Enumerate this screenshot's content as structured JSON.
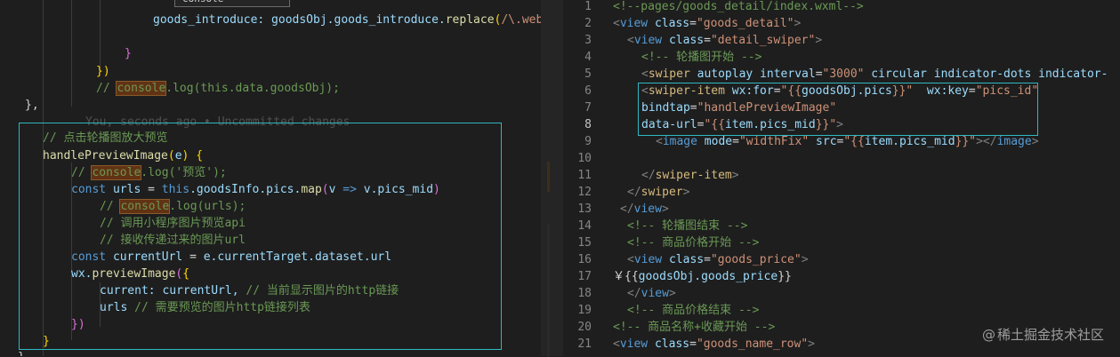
{
  "colors": {
    "background": "#1e1e1e",
    "selection_border": "#2fb8c3",
    "keyword": "#569cd6",
    "function": "#dcdcaa",
    "variable": "#9cdcfe",
    "string": "#ce9178",
    "comment": "#6a9955"
  },
  "left_editor": {
    "suggest_widget_label": "console",
    "lines": [
      [
        {
          "t": "goods_introduce: goodsObj.goods_introduce.",
          "c": "c-var"
        },
        {
          "t": "replace",
          "c": "c-fn"
        },
        {
          "t": "(",
          "c": "c-brk"
        },
        {
          "t": "/\\.webp/g",
          "c": "c-str"
        }
      ],
      [],
      [
        {
          "t": "}",
          "c": "c-brk2"
        }
      ],
      [
        {
          "t": "})",
          "c": "c-brk"
        }
      ],
      [
        {
          "t": "// ",
          "c": "c-cmt"
        },
        {
          "t": "console",
          "c": "c-cmt find"
        },
        {
          "t": ".log(this.data.goodsObj);",
          "c": "c-cmt"
        }
      ],
      [
        {
          "t": "},",
          "c": "c-pun"
        }
      ],
      [
        {
          "t": "You, seconds ago • Uncommitted changes",
          "c": "c-mute"
        }
      ],
      [
        {
          "t": "// 点击轮播图放大预览",
          "c": "c-cmt"
        }
      ],
      [
        {
          "t": "handlePreviewImage",
          "c": "c-fn"
        },
        {
          "t": "(",
          "c": "c-brk"
        },
        {
          "t": "e",
          "c": "c-var"
        },
        {
          "t": ") {",
          "c": "c-brk"
        }
      ],
      [
        {
          "t": "// ",
          "c": "c-cmt"
        },
        {
          "t": "console",
          "c": "c-cmt find"
        },
        {
          "t": ".log('预览');",
          "c": "c-cmt"
        }
      ],
      [
        {
          "t": "const ",
          "c": "c-kw"
        },
        {
          "t": "urls",
          "c": "c-var"
        },
        {
          "t": " = ",
          "c": "c-pun"
        },
        {
          "t": "this",
          "c": "c-kw"
        },
        {
          "t": ".goodsInfo.pics.",
          "c": "c-var"
        },
        {
          "t": "map",
          "c": "c-fn"
        },
        {
          "t": "(",
          "c": "c-brk2"
        },
        {
          "t": "v",
          "c": "c-var"
        },
        {
          "t": " => ",
          "c": "c-kw"
        },
        {
          "t": "v.pics_mid",
          "c": "c-var"
        },
        {
          "t": ")",
          "c": "c-brk2"
        }
      ],
      [
        {
          "t": "// ",
          "c": "c-cmt"
        },
        {
          "t": "console",
          "c": "c-cmt find"
        },
        {
          "t": ".log(urls);",
          "c": "c-cmt"
        }
      ],
      [
        {
          "t": "// 调用小程序图片预览api",
          "c": "c-cmt"
        }
      ],
      [
        {
          "t": "// 接收传递过来的图片url",
          "c": "c-cmt"
        }
      ],
      [
        {
          "t": "const ",
          "c": "c-kw"
        },
        {
          "t": "currentUrl",
          "c": "c-var"
        },
        {
          "t": " = ",
          "c": "c-pun"
        },
        {
          "t": "e.currentTarget.dataset.url",
          "c": "c-var"
        }
      ],
      [
        {
          "t": "wx.",
          "c": "c-var"
        },
        {
          "t": "previewImage",
          "c": "c-fn"
        },
        {
          "t": "(",
          "c": "c-brk2"
        },
        {
          "t": "{",
          "c": "c-brk"
        }
      ],
      [
        {
          "t": "current: currentUrl, ",
          "c": "c-var"
        },
        {
          "t": "// 当前显示图片的http链接",
          "c": "c-cmt"
        }
      ],
      [
        {
          "t": "urls ",
          "c": "c-var"
        },
        {
          "t": "// 需要预览的图片http链接列表",
          "c": "c-cmt"
        }
      ],
      [
        {
          "t": "})",
          "c": "c-brk2"
        }
      ],
      [
        {
          "t": "}",
          "c": "c-brk"
        }
      ],
      [
        {
          "t": "},",
          "c": "c-pun"
        }
      ]
    ]
  },
  "right_editor": {
    "line_numbers": [
      "1",
      "2",
      "3",
      "4",
      "5",
      "6",
      "7",
      "8",
      "9",
      "10",
      "11",
      "12",
      "13",
      "14",
      "15",
      "16",
      "17",
      "18",
      "19",
      "20",
      "21"
    ],
    "active_line": "8",
    "lines": [
      [
        {
          "t": "<!--pages/goods_detail/index.wxml-->",
          "c": "c-cmt"
        }
      ],
      [
        {
          "t": "<",
          "c": "c-tag-gray"
        },
        {
          "t": "view ",
          "c": "c-tag"
        },
        {
          "t": "class",
          "c": "c-attr"
        },
        {
          "t": "=",
          "c": "c-pun"
        },
        {
          "t": "\"goods_detail\"",
          "c": "c-str"
        },
        {
          "t": ">",
          "c": "c-tag-gray"
        }
      ],
      [
        {
          "t": "<",
          "c": "c-tag-gray"
        },
        {
          "t": "view ",
          "c": "c-tag"
        },
        {
          "t": "class",
          "c": "c-attr"
        },
        {
          "t": "=",
          "c": "c-pun"
        },
        {
          "t": "\"detail_swiper\"",
          "c": "c-str"
        },
        {
          "t": ">",
          "c": "c-tag-gray"
        }
      ],
      [
        {
          "t": "<!-- 轮播图开始 -->",
          "c": "c-cmt"
        }
      ],
      [
        {
          "t": "<",
          "c": "c-tag-gray"
        },
        {
          "t": "swiper ",
          "c": "c-hl"
        },
        {
          "t": "autoplay interval",
          "c": "c-attr"
        },
        {
          "t": "=",
          "c": "c-pun"
        },
        {
          "t": "\"3000\"",
          "c": "c-str"
        },
        {
          "t": " circular indicator-dots indicator-col",
          "c": "c-attr"
        }
      ],
      [
        {
          "t": "<",
          "c": "c-tag-gray"
        },
        {
          "t": "swiper-item ",
          "c": "c-hl"
        },
        {
          "t": "wx:for",
          "c": "c-attr"
        },
        {
          "t": "=",
          "c": "c-pun"
        },
        {
          "t": "\"{{",
          "c": "c-str"
        },
        {
          "t": "goodsObj.pics",
          "c": "c-var"
        },
        {
          "t": "}}\"",
          "c": "c-str"
        },
        {
          "t": "  wx:key",
          "c": "c-attr"
        },
        {
          "t": "=",
          "c": "c-pun"
        },
        {
          "t": "\"pics_id\"",
          "c": "c-str"
        }
      ],
      [
        {
          "t": "bindtap",
          "c": "c-attr"
        },
        {
          "t": "=",
          "c": "c-pun"
        },
        {
          "t": "\"handlePreviewImage\"",
          "c": "c-str"
        }
      ],
      [
        {
          "t": "data-url",
          "c": "c-attr"
        },
        {
          "t": "=",
          "c": "c-pun"
        },
        {
          "t": "\"{{",
          "c": "c-str"
        },
        {
          "t": "item.pics_mid",
          "c": "c-var"
        },
        {
          "t": "}}\"",
          "c": "c-str"
        },
        {
          "t": ">",
          "c": "c-tag-gray"
        }
      ],
      [
        {
          "t": "<",
          "c": "c-tag-gray"
        },
        {
          "t": "image ",
          "c": "c-tag"
        },
        {
          "t": "mode",
          "c": "c-attr"
        },
        {
          "t": "=",
          "c": "c-pun"
        },
        {
          "t": "\"widthFix\"",
          "c": "c-str"
        },
        {
          "t": " src",
          "c": "c-attr"
        },
        {
          "t": "=",
          "c": "c-pun"
        },
        {
          "t": "\"{{",
          "c": "c-str"
        },
        {
          "t": "item.pics_mid",
          "c": "c-var"
        },
        {
          "t": "}}\"",
          "c": "c-str"
        },
        {
          "t": "></",
          "c": "c-tag-gray"
        },
        {
          "t": "image",
          "c": "c-tag"
        },
        {
          "t": ">",
          "c": "c-tag-gray"
        }
      ],
      [],
      [
        {
          "t": "</",
          "c": "c-tag-gray"
        },
        {
          "t": "swiper-item",
          "c": "c-hl"
        },
        {
          "t": ">",
          "c": "c-tag-gray"
        }
      ],
      [
        {
          "t": "</",
          "c": "c-tag-gray"
        },
        {
          "t": "swiper",
          "c": "c-hl"
        },
        {
          "t": ">",
          "c": "c-tag-gray"
        }
      ],
      [
        {
          "t": "</",
          "c": "c-tag-gray"
        },
        {
          "t": "view",
          "c": "c-tag"
        },
        {
          "t": ">",
          "c": "c-tag-gray"
        }
      ],
      [
        {
          "t": "<!-- 轮播图结束 -->",
          "c": "c-cmt"
        }
      ],
      [
        {
          "t": "<!-- 商品价格开始 -->",
          "c": "c-cmt"
        }
      ],
      [
        {
          "t": "<",
          "c": "c-tag-gray"
        },
        {
          "t": "view ",
          "c": "c-tag"
        },
        {
          "t": "class",
          "c": "c-attr"
        },
        {
          "t": "=",
          "c": "c-pun"
        },
        {
          "t": "\"goods_price\"",
          "c": "c-str"
        },
        {
          "t": ">",
          "c": "c-tag-gray"
        }
      ],
      [
        {
          "t": "￥{{",
          "c": "c-pun"
        },
        {
          "t": "goodsObj.goods_price",
          "c": "c-var"
        },
        {
          "t": "}}",
          "c": "c-pun"
        }
      ],
      [
        {
          "t": "</",
          "c": "c-tag-gray"
        },
        {
          "t": "view",
          "c": "c-tag"
        },
        {
          "t": ">",
          "c": "c-tag-gray"
        }
      ],
      [
        {
          "t": "<!-- 商品价格结束 -->",
          "c": "c-cmt"
        }
      ],
      [
        {
          "t": "<!-- 商品名称+收藏开始 -->",
          "c": "c-cmt"
        }
      ],
      [
        {
          "t": "<",
          "c": "c-tag-gray"
        },
        {
          "t": "view ",
          "c": "c-tag"
        },
        {
          "t": "class",
          "c": "c-attr"
        },
        {
          "t": "=",
          "c": "c-pun"
        },
        {
          "t": "\"goods_name_row\"",
          "c": "c-str"
        },
        {
          "t": ">",
          "c": "c-tag-gray"
        }
      ]
    ]
  },
  "watermark": {
    "at": "@",
    "text": "稀土掘金技术社区"
  }
}
